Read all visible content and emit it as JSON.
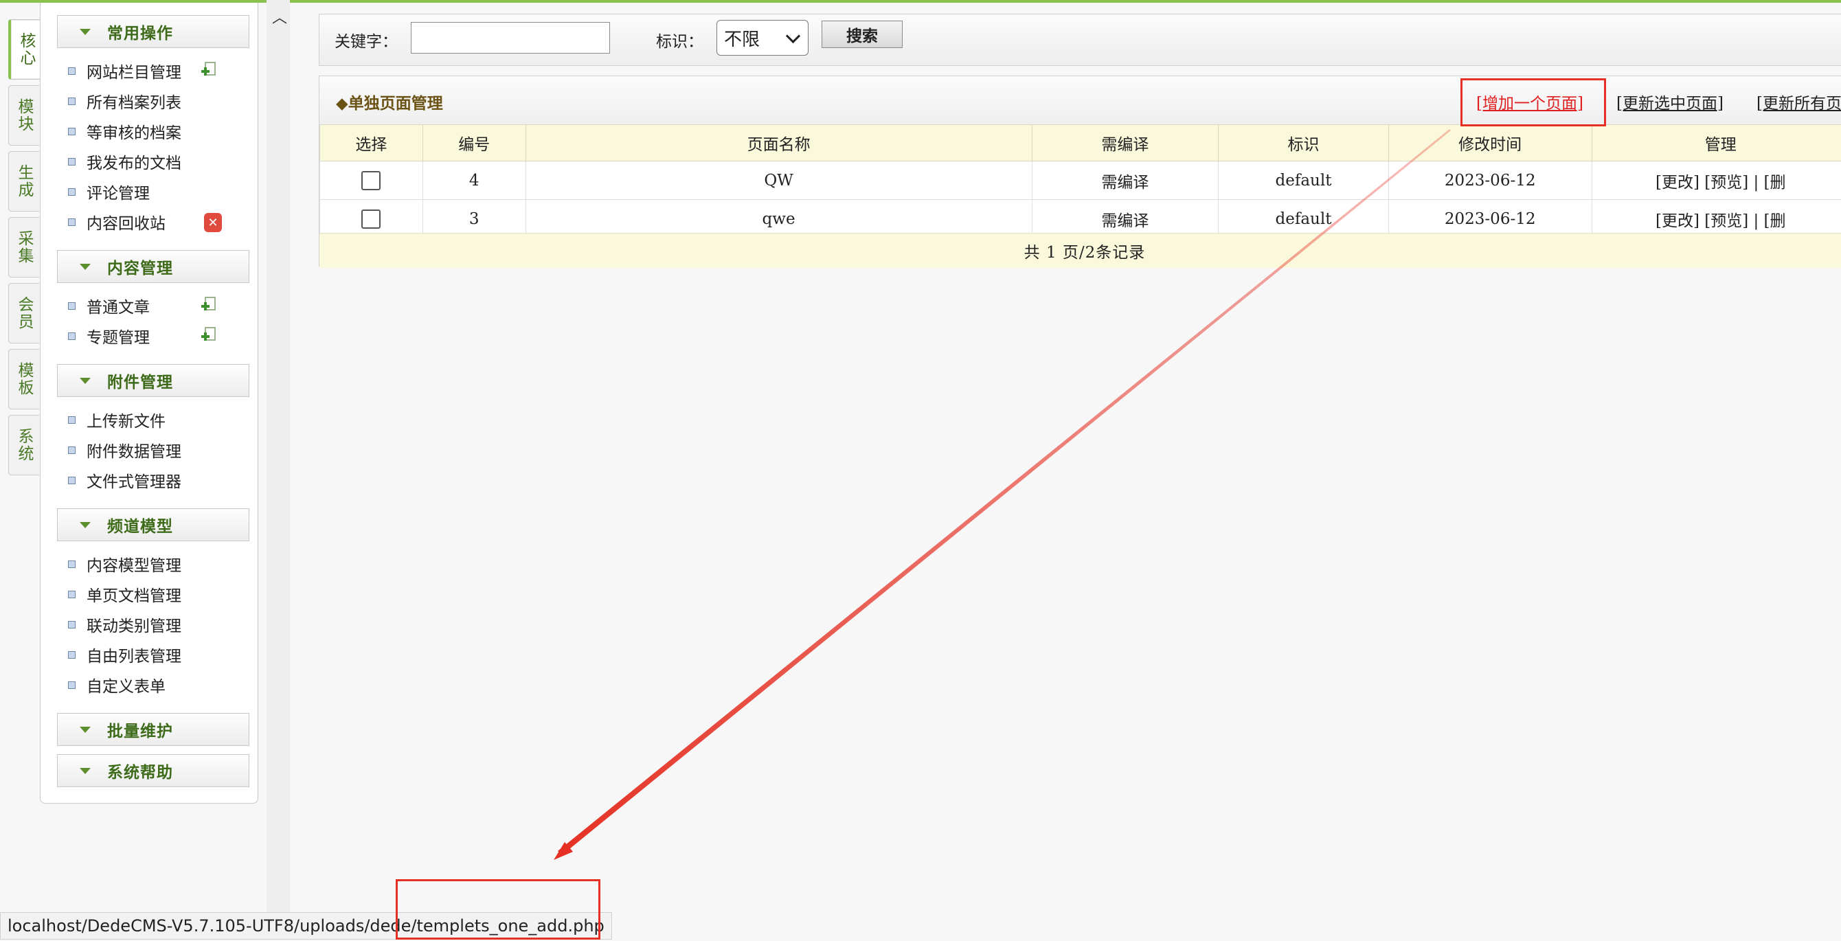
{
  "colors": {
    "accent_green": "#8cc152",
    "group_title": "#3e6b1a",
    "annotation_red": "#e53023",
    "table_header_bg": "#fbf9dc"
  },
  "left_tabs": [
    {
      "label": "核心",
      "active": true
    },
    {
      "label": "模块"
    },
    {
      "label": "生成"
    },
    {
      "label": "采集"
    },
    {
      "label": "会员"
    },
    {
      "label": "模板"
    },
    {
      "label": "系统"
    }
  ],
  "menu": {
    "groups": [
      {
        "title": "常用操作",
        "items": [
          "网站栏目管理",
          "所有档案列表",
          "等审核的档案",
          "我发布的文档",
          "评论管理",
          "内容回收站"
        ]
      },
      {
        "title": "内容管理",
        "items": [
          "普通文章",
          "专题管理"
        ]
      },
      {
        "title": "附件管理",
        "items": [
          "上传新文件",
          "附件数据管理",
          "文件式管理器"
        ]
      },
      {
        "title": "频道模型",
        "items": [
          "内容模型管理",
          "单页文档管理",
          "联动类别管理",
          "自由列表管理",
          "自定义表单"
        ]
      },
      {
        "title": "批量维护",
        "items": []
      },
      {
        "title": "系统帮助",
        "items": []
      }
    ]
  },
  "icons": {
    "collapse": "chevron-up-icon",
    "add": "add-page-icon",
    "delete": "delete-icon",
    "dropdown": "chevron-down-icon"
  },
  "search": {
    "keyword_label": "关键字：",
    "keyword_value": "",
    "flag_label": "标识：",
    "flag_selected": "不限",
    "button": "搜索"
  },
  "panel": {
    "title": "◆单独页面管理",
    "links": [
      "[增加一个页面]",
      "[更新选中页面]",
      "[更新所有页"
    ]
  },
  "table": {
    "columns": [
      "选择",
      "编号",
      "页面名称",
      "需编译",
      "标识",
      "修改时间",
      "管理"
    ],
    "rows": [
      {
        "id": "4",
        "name": "QW",
        "compile": "需编译",
        "flag": "default",
        "mtime": "2023-06-12",
        "actions": "[更改] [预览]  |  [删"
      },
      {
        "id": "3",
        "name": "qwe",
        "compile": "需编译",
        "flag": "default",
        "mtime": "2023-06-12",
        "actions": "[更改] [预览]  |  [删"
      }
    ],
    "footer": "共 1 页/2条记录"
  },
  "status_bar": {
    "url": "localhost/DedeCMS-V5.7.105-UTF8/uploads/dede/templets_one_add.php"
  }
}
